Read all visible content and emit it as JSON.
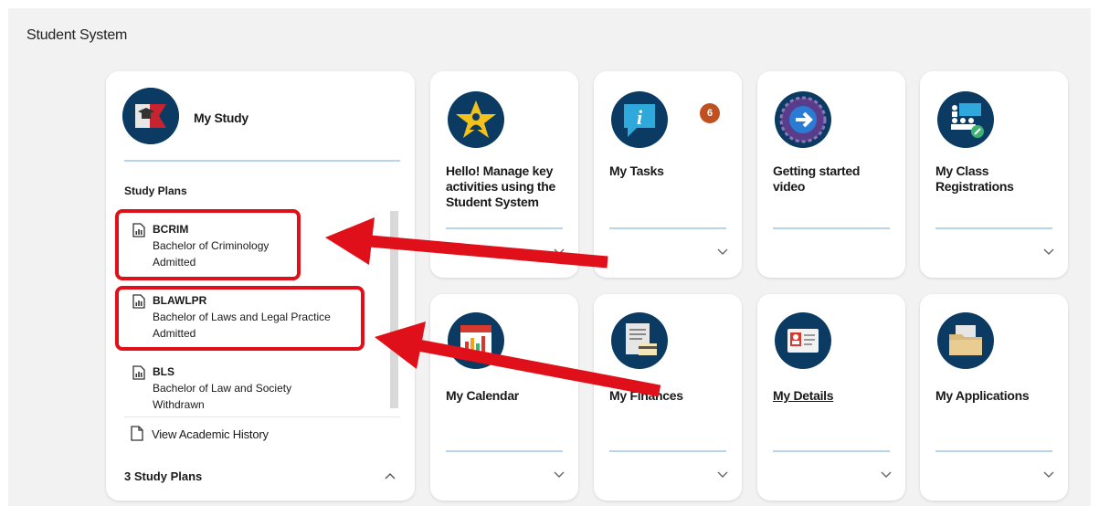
{
  "page": {
    "title": "Student System"
  },
  "my_study": {
    "title": "My Study",
    "section_heading": "Study Plans",
    "plans": [
      {
        "code": "BCRIM",
        "name": "Bachelor of Criminology",
        "status": "Admitted"
      },
      {
        "code": "BLAWLPR",
        "name": "Bachelor of Laws and Legal Practice",
        "status": "Admitted"
      },
      {
        "code": "BLS",
        "name": "Bachelor of Law and Society",
        "status": "Withdrawn"
      }
    ],
    "history_link": "View Academic History",
    "footer_count": "3  Study Plans"
  },
  "tiles": [
    {
      "label": "Hello! Manage key activities using the Student System",
      "icon": "star-person-icon"
    },
    {
      "label": "My Tasks",
      "icon": "info-bubble-icon",
      "badge": "6"
    },
    {
      "label": "Getting started video",
      "icon": "arrow-gear-icon"
    },
    {
      "label": "My Class Registrations",
      "icon": "class-group-icon"
    },
    {
      "label": "My Calendar",
      "icon": "calendar-chart-icon"
    },
    {
      "label": "My Finances",
      "icon": "invoice-card-icon"
    },
    {
      "label": "My Details",
      "icon": "id-card-icon"
    },
    {
      "label": "My Applications",
      "icon": "folder-icon"
    }
  ],
  "colors": {
    "icon_bg": "#0b3b63",
    "highlight": "#e0101a",
    "badge": "#c0501f",
    "divider": "#b7d4ec"
  }
}
